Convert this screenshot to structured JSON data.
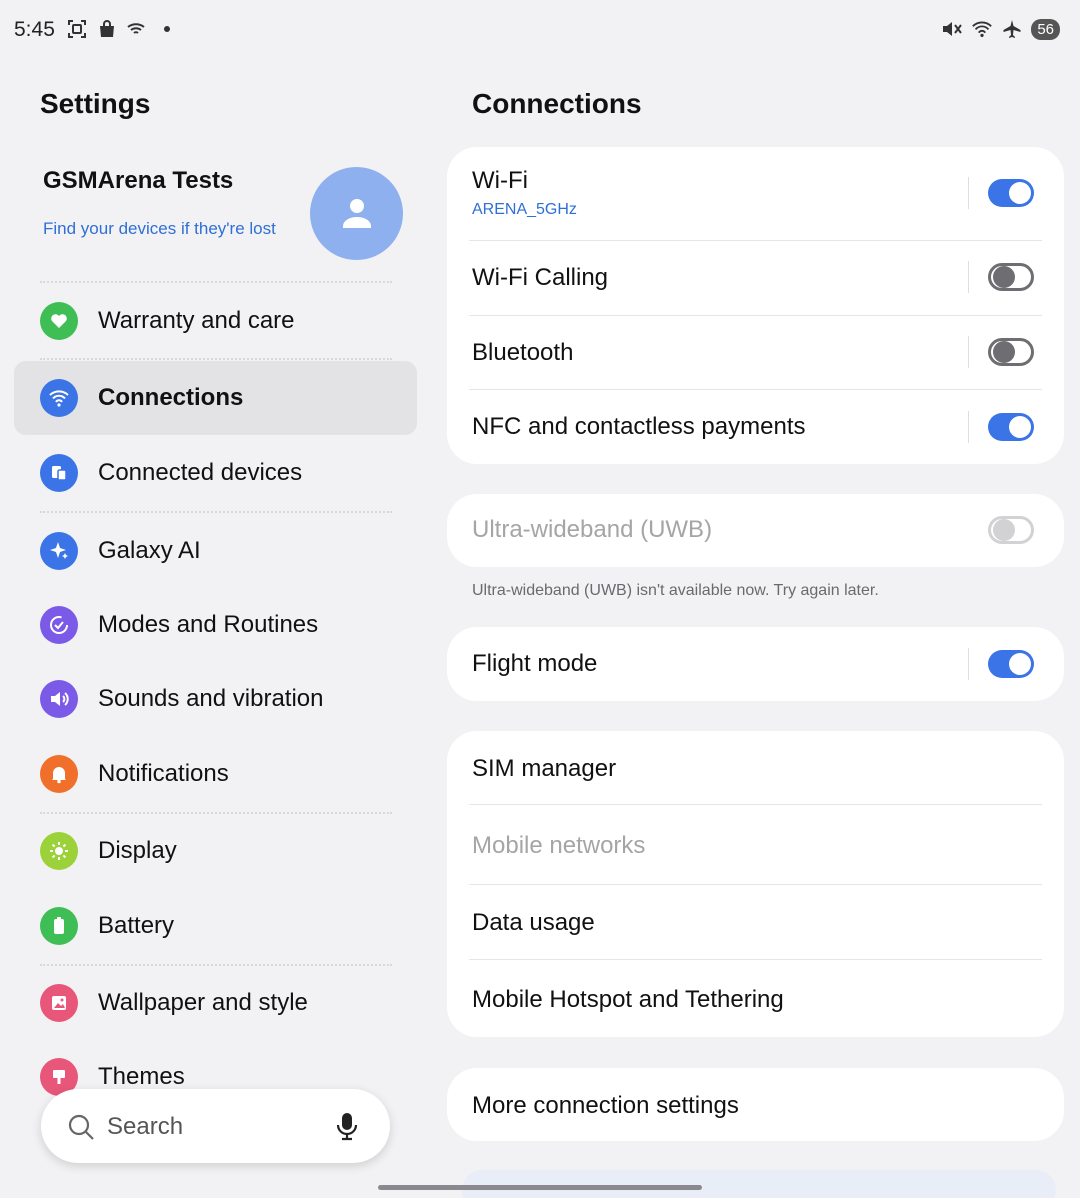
{
  "status_bar": {
    "time": "5:45",
    "left_icons": [
      "screenshot-icon",
      "shopping-bag-icon",
      "wifi-calling-icon",
      "dot-icon"
    ],
    "right_icons": [
      "mute-icon",
      "wifi-icon",
      "airplane-icon"
    ],
    "battery": "56"
  },
  "left": {
    "title": "Settings",
    "profile": {
      "name": "GSMArena Tests",
      "subtitle": "Find your devices if they're lost"
    },
    "items": [
      {
        "label": "Warranty and care",
        "icon": "heart-icon",
        "color": "#3fbe55"
      },
      {
        "label": "Connections",
        "icon": "wifi-icon",
        "color": "#3b74e6",
        "active": true
      },
      {
        "label": "Connected devices",
        "icon": "devices-icon",
        "color": "#3b74e6"
      },
      {
        "label": "Galaxy AI",
        "icon": "sparkle-icon",
        "color": "#3b74e6"
      },
      {
        "label": "Modes and Routines",
        "icon": "routines-icon",
        "color": "#7a5ae6"
      },
      {
        "label": "Sounds and vibration",
        "icon": "speaker-icon",
        "color": "#7a5ae6"
      },
      {
        "label": "Notifications",
        "icon": "bell-icon",
        "color": "#ef6f2b"
      },
      {
        "label": "Display",
        "icon": "sun-icon",
        "color": "#9bd23a"
      },
      {
        "label": "Battery",
        "icon": "battery-icon",
        "color": "#3fbe55"
      },
      {
        "label": "Wallpaper and style",
        "icon": "image-icon",
        "color": "#e8577a"
      },
      {
        "label": "Themes",
        "icon": "brush-icon",
        "color": "#e8577a"
      }
    ],
    "search": {
      "label": "Search"
    }
  },
  "right": {
    "title": "Connections",
    "card1": [
      {
        "title": "Wi-Fi",
        "sub": "ARENA_5GHz",
        "toggle": "on"
      },
      {
        "title": "Wi-Fi Calling",
        "toggle": "off"
      },
      {
        "title": "Bluetooth",
        "toggle": "off"
      },
      {
        "title": "NFC and contactless payments",
        "toggle": "on"
      }
    ],
    "uwb": {
      "title": "Ultra-wideband (UWB)",
      "note": "Ultra-wideband (UWB) isn't available now. Try again later.",
      "toggle": "disabled"
    },
    "flight": {
      "title": "Flight mode",
      "toggle": "on"
    },
    "card3": [
      {
        "title": "SIM manager"
      },
      {
        "title": "Mobile networks",
        "disabled": true
      },
      {
        "title": "Data usage"
      },
      {
        "title": "Mobile Hotspot and Tethering"
      }
    ],
    "more": {
      "title": "More connection settings"
    }
  },
  "colors": {
    "accent": "#3b74e6",
    "link": "#2f6fd6",
    "background": "#f2f2f4"
  }
}
